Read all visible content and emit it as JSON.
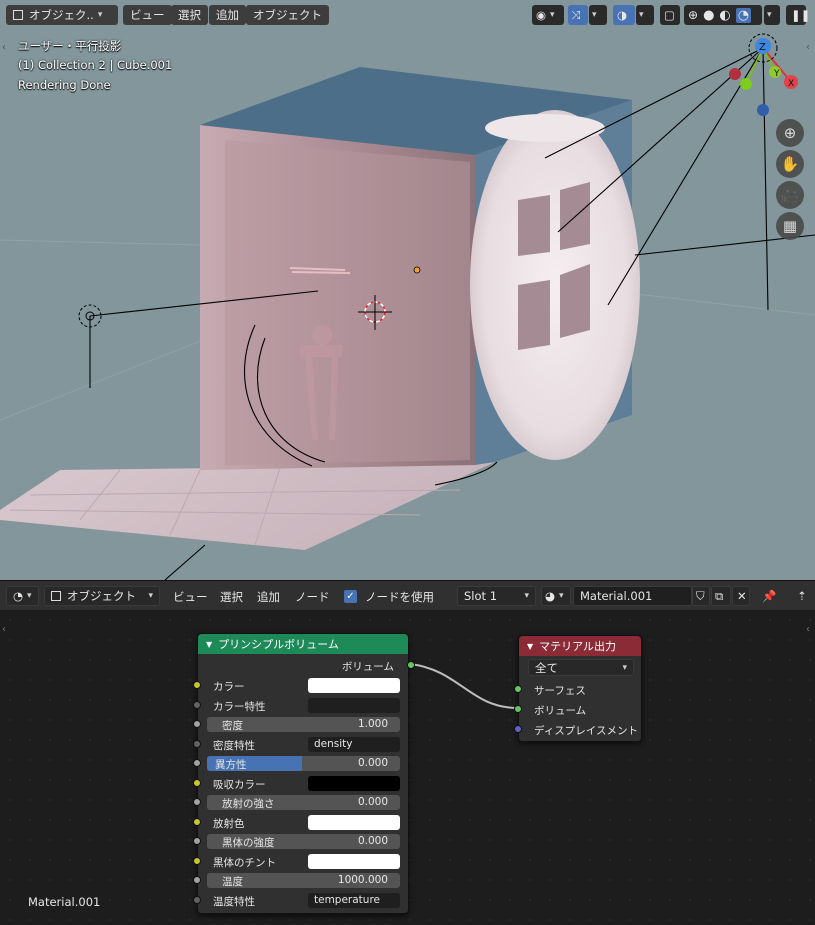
{
  "viewport": {
    "header": {
      "mode_label": "オブジェク..",
      "menu": [
        "ビュー",
        "選択",
        "追加",
        "オブジェクト"
      ]
    },
    "overlay": {
      "view_name": "ユーザー・平行投影",
      "collection": "(1) Collection 2 | Cube.001",
      "status": "Rendering Done"
    },
    "gizmo": {
      "z": "Z",
      "y": "Y",
      "x": "X"
    },
    "colors": {
      "background": "#82969b",
      "active_blue": "#4772b3"
    },
    "icons": [
      "zoom-icon",
      "hand-icon",
      "camera-icon",
      "grid-icon"
    ]
  },
  "node_editor": {
    "header": {
      "mode_label": "オブジェクト",
      "menu": [
        "ビュー",
        "選択",
        "追加",
        "ノード"
      ],
      "use_nodes_label": "ノードを使用",
      "slot": "Slot 1",
      "material": "Material.001"
    },
    "volume_node": {
      "title": "プリンシプルボリューム",
      "title_color": "#1e8a57",
      "output_label": "ボリューム",
      "inputs": [
        {
          "label": "カラー",
          "kind": "color",
          "value": "#ffffff",
          "socket": "#c7c729"
        },
        {
          "label": "カラー特性",
          "kind": "attr",
          "value": "",
          "socket": "#636363"
        },
        {
          "label": "密度",
          "kind": "number",
          "value": "1.000",
          "socket": "#a1a1a1"
        },
        {
          "label": "密度特性",
          "kind": "attr",
          "value": "density",
          "socket": "#636363"
        },
        {
          "label": "異方性",
          "kind": "slider",
          "value": "0.000",
          "socket": "#a1a1a1"
        },
        {
          "label": "吸収カラー",
          "kind": "color",
          "value": "#000000",
          "socket": "#c7c729"
        },
        {
          "label": "放射の強さ",
          "kind": "number",
          "value": "0.000",
          "socket": "#a1a1a1"
        },
        {
          "label": "放射色",
          "kind": "color",
          "value": "#ffffff",
          "socket": "#c7c729"
        },
        {
          "label": "黒体の強度",
          "kind": "number",
          "value": "0.000",
          "socket": "#a1a1a1"
        },
        {
          "label": "黒体のチント",
          "kind": "color",
          "value": "#ffffff",
          "socket": "#c7c729"
        },
        {
          "label": "温度",
          "kind": "number",
          "value": "1000.000",
          "socket": "#a1a1a1"
        },
        {
          "label": "温度特性",
          "kind": "attr",
          "value": "temperature",
          "socket": "#636363"
        }
      ]
    },
    "output_node": {
      "title": "マテリアル出力",
      "title_color": "#8a2b36",
      "target": "全て",
      "inputs": [
        {
          "label": "サーフェス",
          "socket": "#63c763"
        },
        {
          "label": "ボリューム",
          "socket": "#63c763"
        },
        {
          "label": "ディスプレイスメント",
          "socket": "#6363c7"
        }
      ]
    },
    "material_label": "Material.001"
  }
}
